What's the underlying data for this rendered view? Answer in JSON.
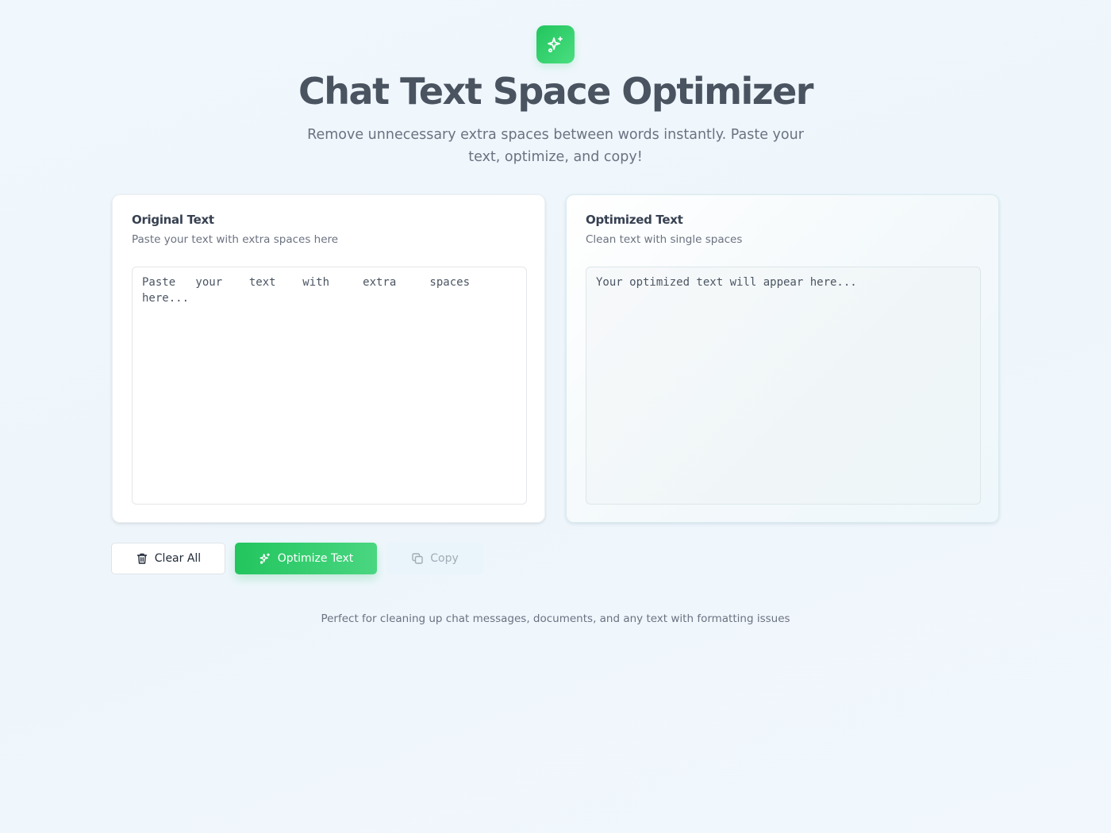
{
  "header": {
    "logo_icon": "sparkles-icon",
    "title": "Chat Text Space Optimizer",
    "subtitle": "Remove unnecessary extra spaces between words instantly. Paste your text, optimize, and copy!"
  },
  "original_panel": {
    "title": "Original Text",
    "description": "Paste your text with extra spaces here",
    "value": "",
    "placeholder": "Paste   your    text    with     extra     spaces     here..."
  },
  "optimized_panel": {
    "title": "Optimized Text",
    "description": "Clean text with single spaces",
    "value": "",
    "placeholder": "Your optimized text will appear here..."
  },
  "actions": {
    "clear": {
      "label": "Clear All",
      "icon": "trash-icon"
    },
    "optimize": {
      "label": "Optimize Text",
      "icon": "sparkles-icon"
    },
    "copy": {
      "label": "Copy",
      "icon": "copy-icon",
      "disabled": true
    }
  },
  "footer": {
    "text": "Perfect for cleaning up chat messages, documents, and any text with formatting issues"
  },
  "colors": {
    "accent": "#22c55e",
    "accent_light": "#4ade80",
    "background": "#f0f7fd",
    "title": "#4a5360",
    "muted": "#6b7280"
  }
}
